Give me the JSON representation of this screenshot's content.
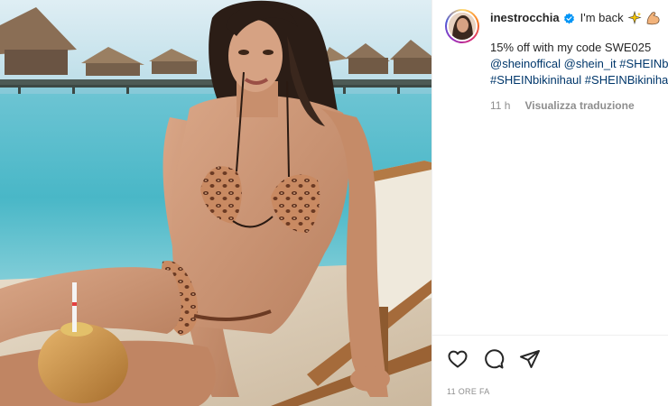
{
  "post": {
    "username": "inestrocchia",
    "caption_text": "I'm back",
    "caption_emojis": [
      "sparkles-icon",
      "flexed-biceps-icon"
    ],
    "body_lines": [
      [
        {
          "text": "15% off with my code SWE025",
          "tag": false
        }
      ],
      [
        {
          "text": "@sheinoffical",
          "tag": true
        },
        {
          "text": " ",
          "tag": false
        },
        {
          "text": "@shein_it",
          "tag": true
        },
        {
          "text": " ",
          "tag": false
        },
        {
          "text": "#SHEINbikinihaul",
          "tag": true
        }
      ],
      [
        {
          "text": "#SHEINbikinihaul",
          "tag": true
        },
        {
          "text": " ",
          "tag": false
        },
        {
          "text": "#SHEINBikinihaul",
          "tag": true
        }
      ]
    ],
    "time_ago": "11 h",
    "translate_label": "Visualizza traduzione",
    "timestamp": "11 ORE FA"
  },
  "actions": [
    {
      "name": "like-button",
      "icon": "heart-icon"
    },
    {
      "name": "comment-button",
      "icon": "comment-icon"
    },
    {
      "name": "share-button",
      "icon": "paper-plane-icon"
    }
  ],
  "colors": {
    "text": "#262626",
    "tag": "#00376b",
    "muted": "#8e8e8e",
    "verified": "#0095f6",
    "divider": "#efefef"
  }
}
